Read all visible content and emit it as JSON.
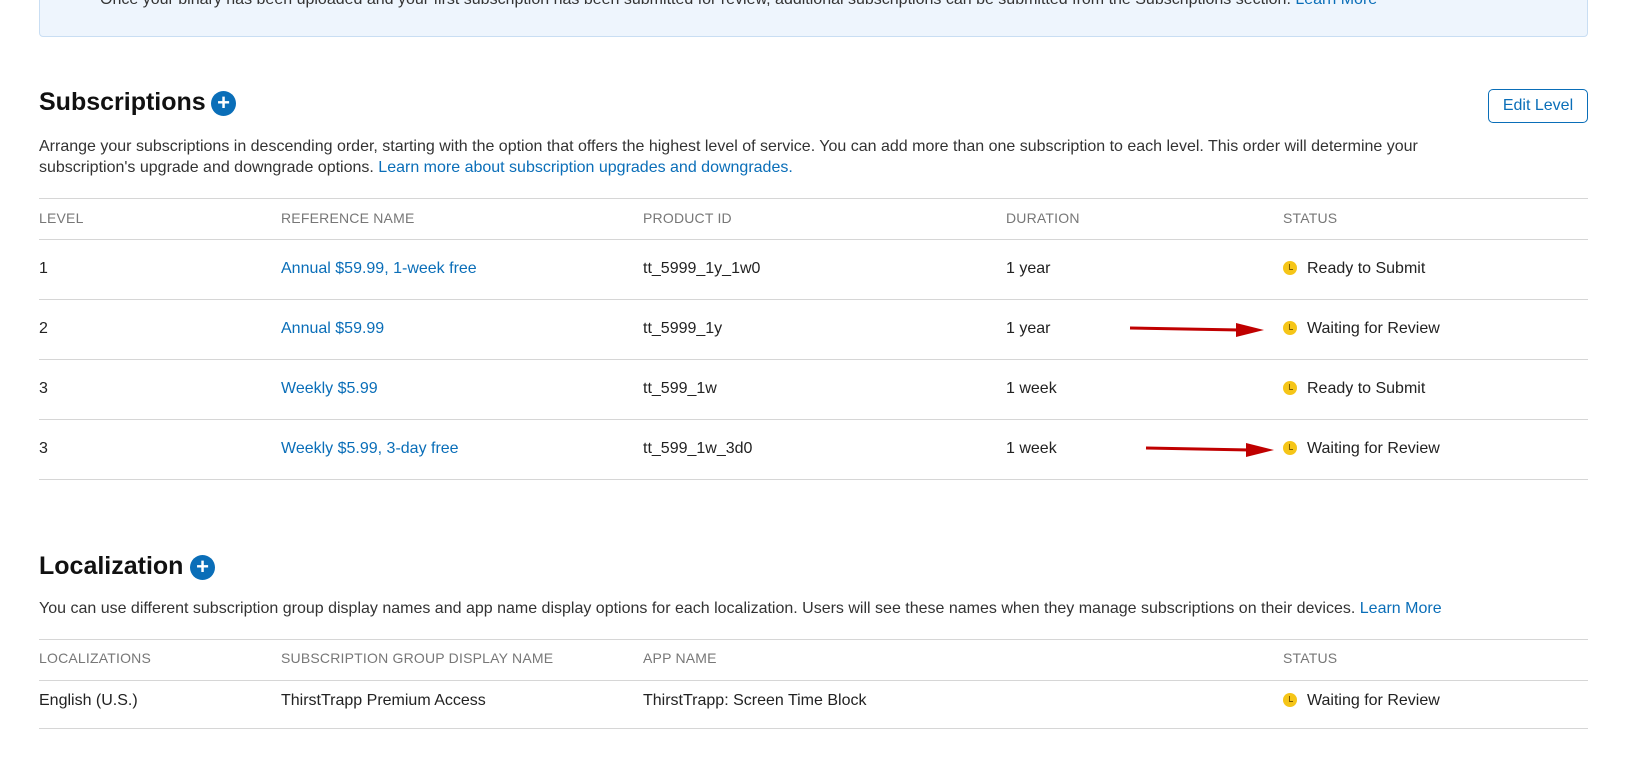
{
  "banner": {
    "text": "Once your binary has been uploaded and your first subscription has been submitted for review, additional subscriptions can be submitted from the Subscriptions section.",
    "link": "Learn More"
  },
  "subscriptions": {
    "title": "Subscriptions",
    "add_icon": "plus-icon",
    "edit_button": "Edit Level",
    "description": "Arrange your subscriptions in descending order, starting with the option that offers the highest level of service. You can add more than one subscription to each level. This order will determine your subscription's upgrade and downgrade options.",
    "description_link": "Learn more about subscription upgrades and downgrades.",
    "columns": [
      "LEVEL",
      "REFERENCE NAME",
      "PRODUCT ID",
      "DURATION",
      "STATUS"
    ],
    "rows": [
      {
        "level": "1",
        "name": "Annual $59.99, 1-week free",
        "product_id": "tt_5999_1y_1w0",
        "duration": "1 year",
        "status": "Ready to Submit",
        "arrow": false
      },
      {
        "level": "2",
        "name": "Annual $59.99",
        "product_id": "tt_5999_1y",
        "duration": "1 year",
        "status": "Waiting for Review",
        "arrow": true
      },
      {
        "level": "3",
        "name": "Weekly $5.99",
        "product_id": "tt_599_1w",
        "duration": "1 week",
        "status": "Ready to Submit",
        "arrow": false
      },
      {
        "level": "3",
        "name": "Weekly $5.99, 3-day free",
        "product_id": "tt_599_1w_3d0",
        "duration": "1 week",
        "status": "Waiting for Review",
        "arrow": true
      }
    ]
  },
  "localization": {
    "title": "Localization",
    "add_icon": "plus-icon",
    "description": "You can use different subscription group display names and app name display options for each localization. Users will see these names when they manage subscriptions on their devices.",
    "description_link": "Learn More",
    "columns": [
      "LOCALIZATIONS",
      "SUBSCRIPTION GROUP DISPLAY NAME",
      "APP NAME",
      "STATUS"
    ],
    "rows": [
      {
        "locale": "English (U.S.)",
        "group_name": "ThirstTrapp Premium Access",
        "app_name": "ThirstTrapp: Screen Time Block",
        "status": "Waiting for Review"
      }
    ]
  },
  "colors": {
    "accent": "#0a6eb8",
    "status_pending": "#f5c518",
    "annotation_arrow": "#c00000"
  }
}
